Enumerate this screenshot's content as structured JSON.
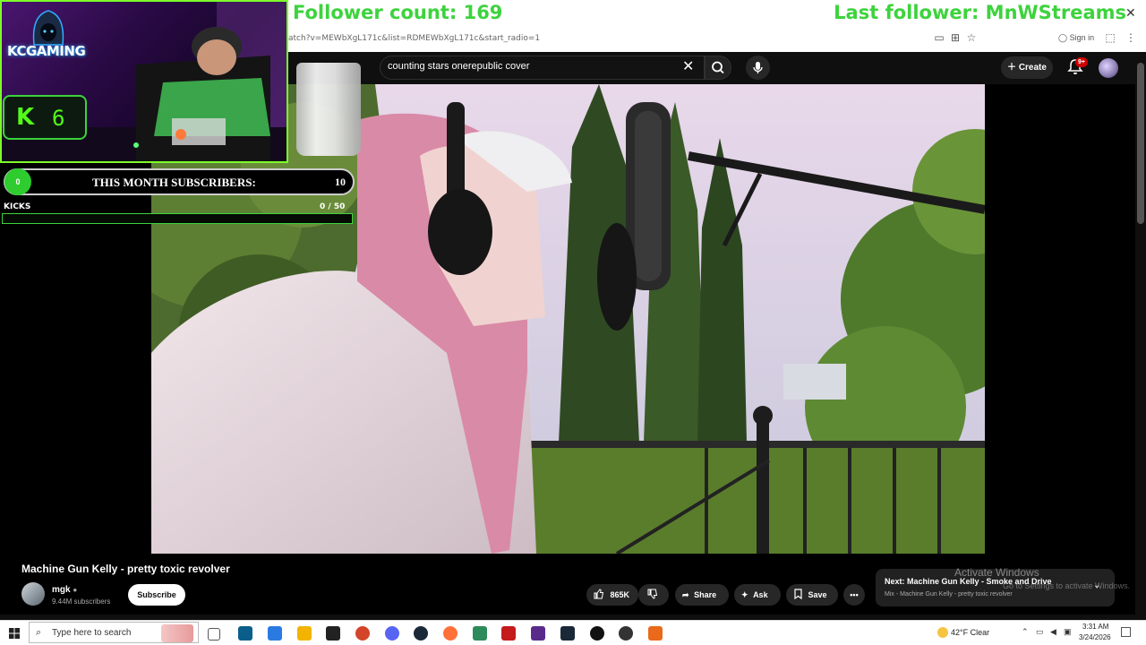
{
  "overlay": {
    "follower_count": "Follower count: 169",
    "last_follower": "Last follower: MnWStreams",
    "logo_text": "KCGAMING",
    "kick_letter": "K",
    "kick_count": "6",
    "subscriber_badge": "0",
    "subscriber_label": "THIS MONTH SUBSCRIBERS:",
    "subscriber_count": "10",
    "kicks_label": "KICKS",
    "kicks_count": "0 / 50"
  },
  "browser": {
    "url": "atch?v=MEWbXgL171c&list=RDMEWbXgL171c&start_radio=1",
    "signin": "Sign in"
  },
  "youtube_header": {
    "search_value": "counting stars onerepublic cover",
    "create_label": "Create",
    "notification_badge": "9+"
  },
  "video": {
    "title": "Machine Gun Kelly - pretty toxic revolver",
    "channel_name": "mgk",
    "channel_subscribers": "9.44M subscribers",
    "subscribe_label": "Subscribe",
    "like_count": "865K",
    "share_label": "Share",
    "ask_label": "Ask",
    "save_label": "Save"
  },
  "next_up": {
    "title": "Next: Machine Gun Kelly - Smoke and Drive",
    "subtitle": "Mix - Machine Gun Kelly - pretty toxic revolver"
  },
  "watermark": {
    "line1": "Activate Windows",
    "line2": "Go to Settings to activate Windows."
  },
  "taskbar": {
    "search_placeholder": "Type here to search",
    "weather": "42°F  Clear",
    "time": "3:31 AM",
    "date": "3/24/2026"
  },
  "colors": {
    "overlay_green": "#3dd33d",
    "kick_green": "#53fc18",
    "youtube_dark": "#0f0f0f",
    "pill_bg": "#272727",
    "badge_red": "#cc0000"
  }
}
